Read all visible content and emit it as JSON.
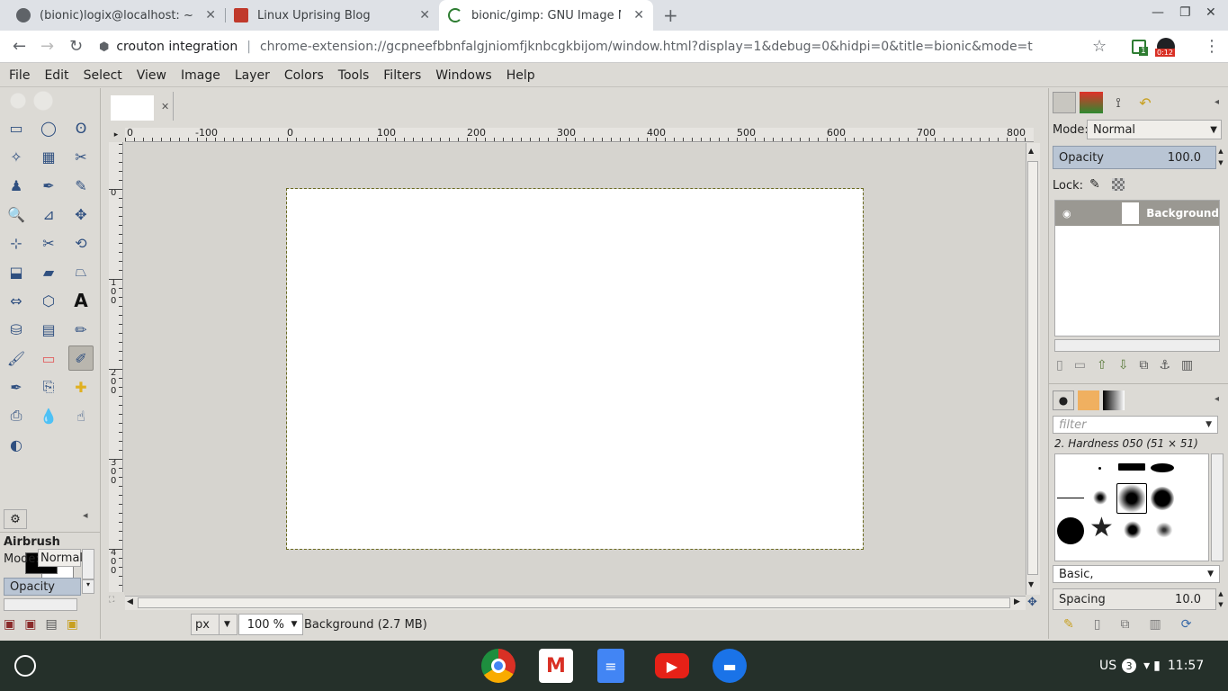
{
  "browser": {
    "tabs": [
      {
        "title": "(bionic)logix@localhost: ~/pych",
        "active": false
      },
      {
        "title": "Linux Uprising Blog",
        "active": false
      },
      {
        "title": "bionic/gimp: GNU Image Manip",
        "active": true
      }
    ],
    "address": {
      "origin": "crouton integration",
      "url": "chrome-extension://gcpneefbbnfalgjniomfjknbcgkbijom/window.html?display=1&debug=0&hidpi=0&title=bionic&mode=t"
    },
    "extension_badge": "0:12",
    "extension_count": "1"
  },
  "menu": [
    "File",
    "Edit",
    "Select",
    "View",
    "Image",
    "Layer",
    "Colors",
    "Tools",
    "Filters",
    "Windows",
    "Help"
  ],
  "toolbox": {
    "tools": [
      "rect-select-icon",
      "ellipse-select-icon",
      "lasso-icon",
      "fuzzy-select-icon",
      "color-select-icon",
      "scissors-icon",
      "foreground-select-icon",
      "paths-icon",
      "color-picker-icon",
      "zoom-icon",
      "measure-icon",
      "move-icon",
      "align-icon",
      "crop-icon",
      "rotate-icon",
      "scale-icon",
      "shear-icon",
      "perspective-icon",
      "flip-icon",
      "cage-icon",
      "text-icon",
      "bucket-fill-icon",
      "blend-icon",
      "pencil-icon",
      "paintbrush-icon",
      "eraser-icon",
      "airbrush-icon",
      "ink-icon",
      "clone-icon",
      "heal-icon",
      "perspective-clone-icon",
      "blur-icon",
      "smudge-icon",
      "dodge-burn-icon"
    ],
    "fg_color": "#000000",
    "bg_color": "#ffffff",
    "options": {
      "tool_name": "Airbrush",
      "mode_label": "Mode:",
      "mode_value": "Normal",
      "opacity_label": "Opacity"
    }
  },
  "image": {
    "h_ruler": [
      "0",
      "-100",
      "0",
      "100",
      "200",
      "300",
      "400",
      "500",
      "600",
      "700",
      "800"
    ],
    "v_ruler": [
      "0",
      "1\n0\n0",
      "2\n0\n0",
      "3\n0\n0",
      "4\n0\n0"
    ],
    "status": {
      "unit": "px",
      "zoom": "100 %",
      "info": "Background (2.7 MB)"
    }
  },
  "layers": {
    "mode_label": "Mode:",
    "mode_value": "Normal",
    "opacity_label": "Opacity",
    "opacity_value": "100.0",
    "lock_label": "Lock:",
    "layer_name": "Background"
  },
  "brushes": {
    "filter_placeholder": "filter",
    "selected": "2. Hardness 050 (51 × 51)",
    "tag": "Basic,",
    "spacing_label": "Spacing",
    "spacing_value": "10.0"
  },
  "shelf": {
    "apps": [
      "chrome-icon",
      "gmail-icon",
      "docs-icon",
      "youtube-icon",
      "files-icon"
    ],
    "locale": "US",
    "notif_count": "3",
    "time": "11:57"
  }
}
